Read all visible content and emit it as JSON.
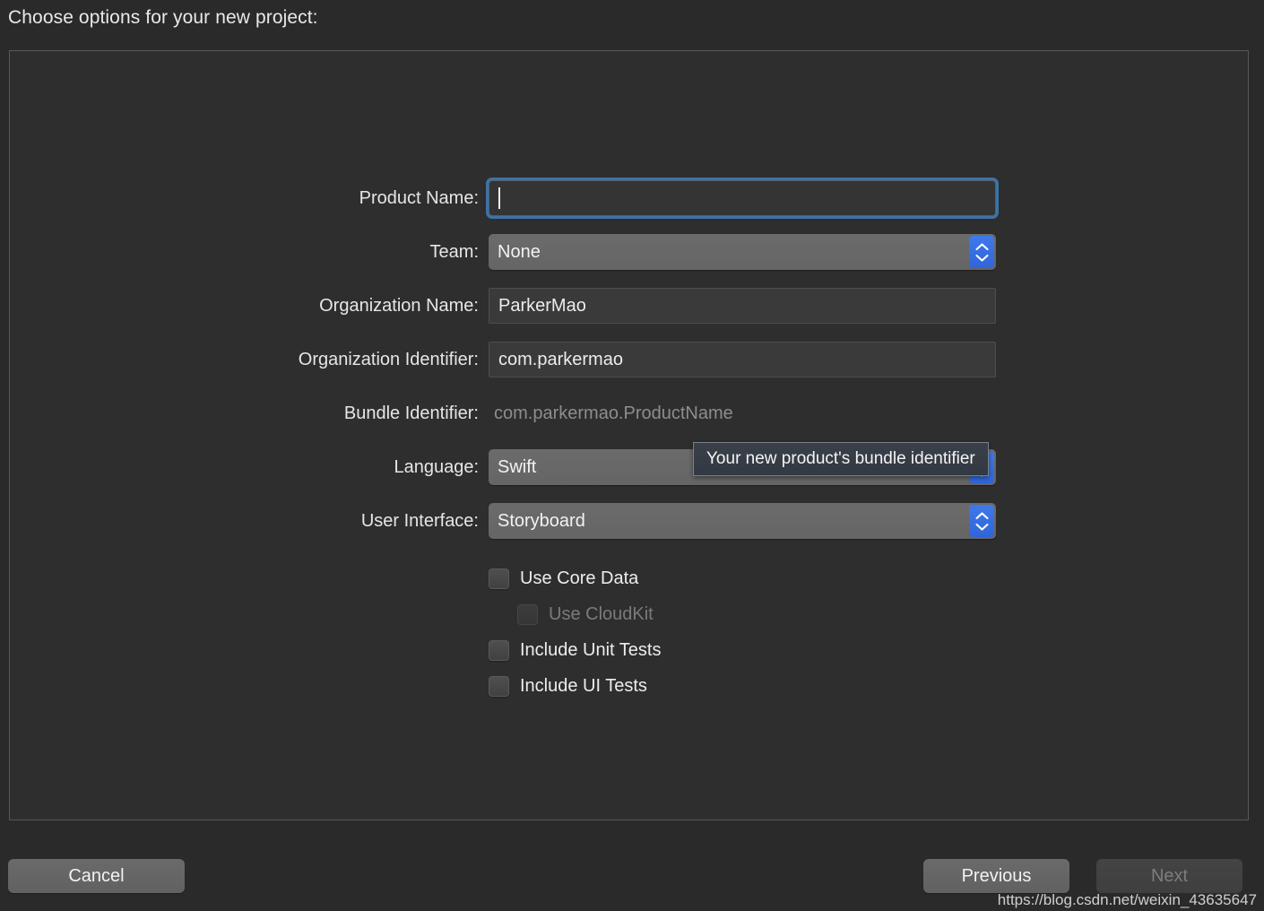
{
  "header": {
    "prompt": "Choose options for your new project:"
  },
  "form": {
    "fields": [
      {
        "label": "Product Name:",
        "value": "",
        "type": "text",
        "focused": true
      },
      {
        "label": "Team:",
        "value": "None",
        "type": "popup"
      },
      {
        "label": "Organization Name:",
        "value": "ParkerMao",
        "type": "text"
      },
      {
        "label": "Organization Identifier:",
        "value": "com.parkermao",
        "type": "text"
      },
      {
        "label": "Bundle Identifier:",
        "value": "com.parkermao.ProductName",
        "type": "static"
      },
      {
        "label": "Language:",
        "value": "Swift",
        "type": "popup"
      },
      {
        "label": "User Interface:",
        "value": "Storyboard",
        "type": "popup"
      }
    ]
  },
  "checkboxes": [
    {
      "label": "Use Core Data",
      "checked": false,
      "disabled": false,
      "indented": false
    },
    {
      "label": "Use CloudKit",
      "checked": false,
      "disabled": true,
      "indented": true
    },
    {
      "label": "Include Unit Tests",
      "checked": false,
      "disabled": false,
      "indented": false
    },
    {
      "label": "Include UI Tests",
      "checked": false,
      "disabled": false,
      "indented": false
    }
  ],
  "tooltip": {
    "text": "Your new product's bundle identifier"
  },
  "buttons": {
    "cancel": "Cancel",
    "previous": "Previous",
    "next": "Next",
    "next_disabled": true
  },
  "watermark": {
    "text": "https://blog.csdn.net/weixin_43635647"
  },
  "colors": {
    "page_background": "#2a2a2a",
    "panel_background": "#2e2e2e",
    "panel_border": "#585858",
    "focus_ring": "#3b73ab",
    "stepper_blue": "#3f79ea",
    "text_primary": "#ededed",
    "text_disabled": "#7b7b7b",
    "field_background": "#3a3a3a",
    "popup_background": "#6b6b6b",
    "tooltip_background": "#3a4049"
  }
}
